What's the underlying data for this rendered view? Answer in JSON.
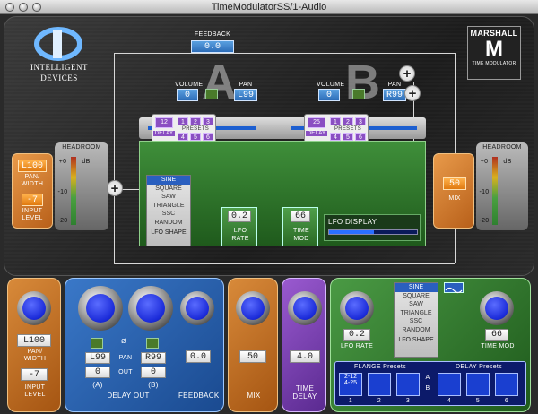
{
  "window": {
    "title": "TimeModulatorSS/1-Audio"
  },
  "brand": {
    "company_line1": "INTELLIGENT",
    "company_line2": "DEVICES",
    "product_mark": "M",
    "product_name": "MARSHALL",
    "product_sub": "TIME MODULATOR"
  },
  "top": {
    "feedback_label": "FEEDBACK",
    "feedback_value": "0.0",
    "letter_a": "A",
    "letter_b": "B",
    "volume_a_label": "VOLUME",
    "volume_a_value": "0",
    "pan_a_label": "PAN",
    "pan_a_value": "L99",
    "volume_b_label": "VOLUME",
    "volume_b_value": "0",
    "pan_b_label": "PAN",
    "pan_b_value": "R99",
    "delay_a_value": "12",
    "delay_a_label": "DELAY",
    "delay_b_value": "25",
    "delay_b_label": "DELAY",
    "presets_label": "PRESETS",
    "preset_nums": [
      "1",
      "2",
      "3",
      "4",
      "5",
      "6"
    ],
    "headroom_left": "HEADROOM",
    "headroom_right": "HEADROOM",
    "db_ticks": [
      "+0",
      "-10",
      "-20"
    ],
    "db_unit": "dB",
    "pan_width_value": "L100",
    "pan_width_label1": "PAN/",
    "pan_width_label2": "WIDTH",
    "input_level_value": "-7",
    "input_level_label1": "INPUT",
    "input_level_label2": "LEVEL",
    "mix_value": "50",
    "mix_label": "MIX",
    "lfo_shapes": [
      "SINE",
      "SQUARE",
      "SAW",
      "TRIANGLE",
      "SSC",
      "RANDOM"
    ],
    "lfo_shape_label": "LFO SHAPE",
    "lfo_rate_value": "0.2",
    "lfo_rate_label1": "LFO",
    "lfo_rate_label2": "RATE",
    "time_mod_value": "66",
    "time_mod_label1": "TIME",
    "time_mod_label2": "MOD",
    "lfo_display_label": "LFO DISPLAY"
  },
  "bottom": {
    "pan_width_value": "L100",
    "pan_width_label1": "PAN/",
    "pan_width_label2": "WIDTH",
    "input_level_value": "-7",
    "input_level_label1": "INPUT",
    "input_level_label2": "LEVEL",
    "phase_symbol": "Ø",
    "pan_a_value": "L99",
    "pan_label": "PAN",
    "pan_b_value": "R99",
    "out_a_value": "0",
    "out_label": "OUT",
    "out_b_value": "0",
    "a_label": "(A)",
    "b_label": "(B)",
    "delay_out_label": "DELAY OUT",
    "feedback_value": "0.0",
    "feedback_label": "FEEDBACK",
    "mix_value": "50",
    "mix_label": "MIX",
    "time_delay_value": "4.0",
    "time_delay_label1": "TIME",
    "time_delay_label2": "DELAY",
    "lfo_rate_value": "0.2",
    "lfo_rate_label": "LFO RATE",
    "lfo_shapes": [
      "SINE",
      "SQUARE",
      "SAW",
      "TRIANGLE",
      "SSC",
      "RANDOM"
    ],
    "lfo_shape_label": "LFO SHAPE",
    "time_mod_value": "66",
    "time_mod_label": "TIME MOD",
    "flange_presets_label": "FLANGE Presets",
    "delay_presets_label": "DELAY Presets",
    "flange_slot1_line1": "2-12",
    "flange_slot1_line2": "4-25",
    "ab_a": "A",
    "ab_b": "B",
    "slot_nums": [
      "1",
      "2",
      "3",
      "4",
      "5",
      "6"
    ]
  },
  "colors": {
    "accent_blue": "#1a2ad8",
    "orange": "#e07a10",
    "green": "#3f8f3a",
    "purple": "#8a4fc2"
  }
}
